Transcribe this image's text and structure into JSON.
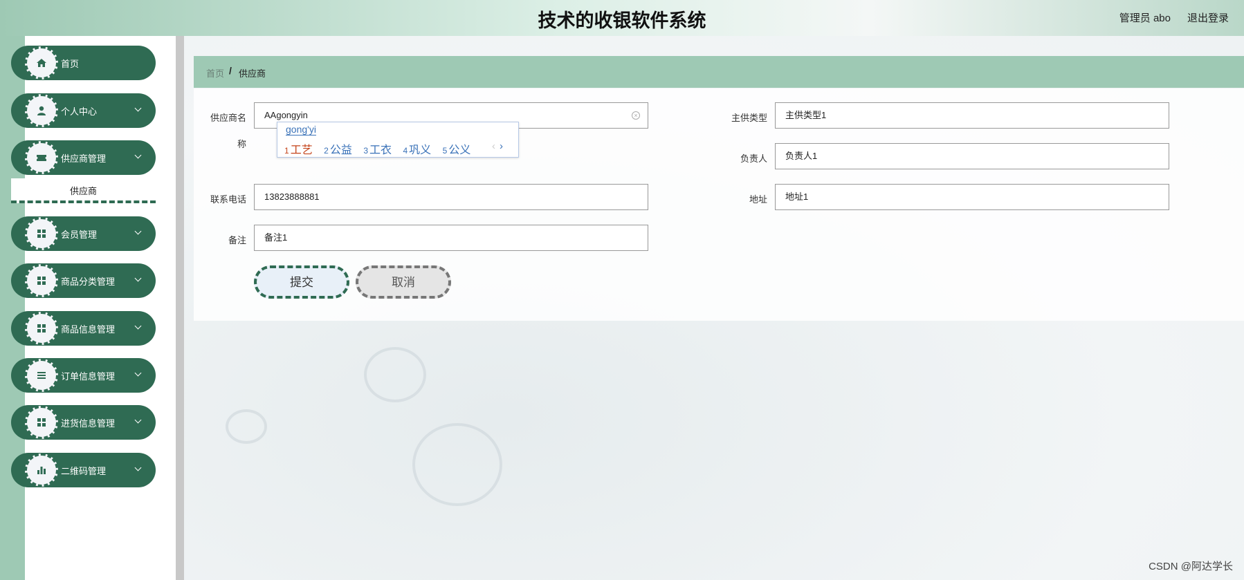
{
  "header": {
    "title": "技术的收银软件系统",
    "user": "管理员 abo",
    "logout": "退出登录"
  },
  "sidebar": {
    "items": [
      {
        "label": "首页",
        "icon": "home-icon"
      },
      {
        "label": "个人中心",
        "icon": "user-icon"
      },
      {
        "label": "供应商管理",
        "icon": "ticket-icon"
      },
      {
        "label": "会员管理",
        "icon": "grid-icon"
      },
      {
        "label": "商品分类管理",
        "icon": "grid-icon"
      },
      {
        "label": "商品信息管理",
        "icon": "grid-icon"
      },
      {
        "label": "订单信息管理",
        "icon": "list-icon"
      },
      {
        "label": "进货信息管理",
        "icon": "grid-icon"
      },
      {
        "label": "二维码管理",
        "icon": "bar-chart-icon"
      }
    ],
    "submenu": {
      "label": "供应商"
    }
  },
  "breadcrumb": {
    "home": "首页",
    "sep": "/",
    "current": "供应商"
  },
  "form": {
    "supplier_name_label_1": "供应商名",
    "supplier_name_label_2": "称",
    "supplier_name_value": "AAgongyin",
    "main_type_label": "主供类型",
    "main_type_value": "主供类型1",
    "person_label": "负责人",
    "person_value": "负责人1",
    "phone_label": "联系电话",
    "phone_value": "13823888881",
    "address_label": "地址",
    "address_value": "地址1",
    "remark_label": "备注",
    "remark_value": "备注1",
    "submit": "提交",
    "cancel": "取消"
  },
  "ime": {
    "composition": "gong'yi",
    "candidates": [
      {
        "num": "1",
        "text": "工艺"
      },
      {
        "num": "2",
        "text": "公益"
      },
      {
        "num": "3",
        "text": "工衣"
      },
      {
        "num": "4",
        "text": "巩义"
      },
      {
        "num": "5",
        "text": "公义"
      }
    ],
    "prev": "‹",
    "next": "›"
  },
  "watermark": "CSDN @阿达学长",
  "colors": {
    "accent": "#2f6b53",
    "light_accent": "#9ec9b4"
  }
}
